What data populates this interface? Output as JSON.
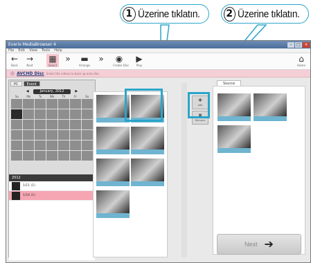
{
  "callouts": [
    {
      "number": "1",
      "text": "Üzerine tıklatın."
    },
    {
      "number": "2",
      "text": "Üzerine tıklatın."
    }
  ],
  "window": {
    "title": "Everio MediaBrowser 4",
    "menu": [
      "File",
      "Edit",
      "View",
      "Tools",
      "Help"
    ],
    "toolbar": [
      {
        "label": "Back",
        "icon": "←"
      },
      {
        "label": "Next",
        "icon": "→"
      },
      {
        "label": "Select",
        "icon": "▦"
      },
      {
        "label": "",
        "icon": "»"
      },
      {
        "label": "Arrange",
        "icon": "▬"
      },
      {
        "label": "",
        "icon": "»"
      },
      {
        "label": "Create Disc",
        "icon": "◉"
      },
      {
        "label": "Play",
        "icon": "▶"
      },
      {
        "label": "Home",
        "icon": "⌂"
      }
    ],
    "infobar": {
      "link": "AVCHD Disc",
      "text": "Select the videos to back up onto disc."
    },
    "tabs": [
      "PC",
      "Event"
    ],
    "calendar": {
      "month": "January, 2012",
      "days_of_week": [
        "Su",
        "Mo",
        "Tu",
        "We",
        "Th",
        "Fr",
        "Sa"
      ]
    },
    "year": "2012",
    "list_items": [
      "1/11 (1)",
      "1/16 (1)"
    ],
    "right_tab": "Source",
    "side_buttons": [
      {
        "label": "Add",
        "icon": "✚"
      },
      {
        "label": "Remove",
        "icon": "✖"
      }
    ],
    "next_button": {
      "label": "Next",
      "icon": "➔"
    }
  }
}
